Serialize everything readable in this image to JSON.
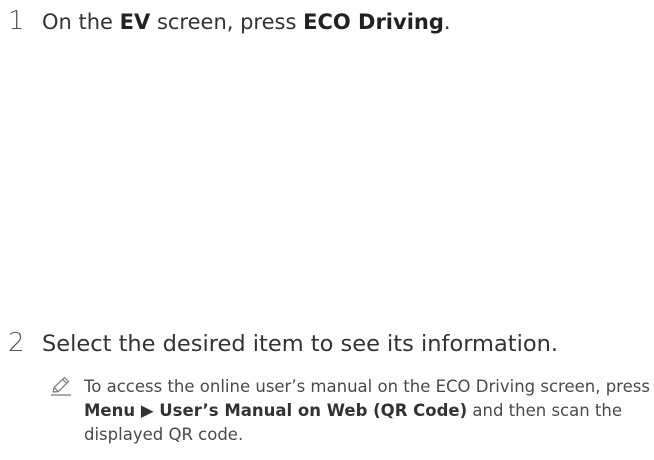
{
  "steps": [
    {
      "number": "1",
      "parts": {
        "t1": "On the ",
        "b1": "EV",
        "t2": " screen, press ",
        "b2": "ECO Driving",
        "t3": "."
      }
    },
    {
      "number": "2",
      "text": "Select the desired item to see its information."
    }
  ],
  "note": {
    "icon": "pencil-icon",
    "t1": "To access the online user’s manual on the ECO Driving screen, press ",
    "b1": "Menu ▶ User’s Manual on Web (QR Code)",
    "t2": " and then scan the displayed QR code."
  }
}
